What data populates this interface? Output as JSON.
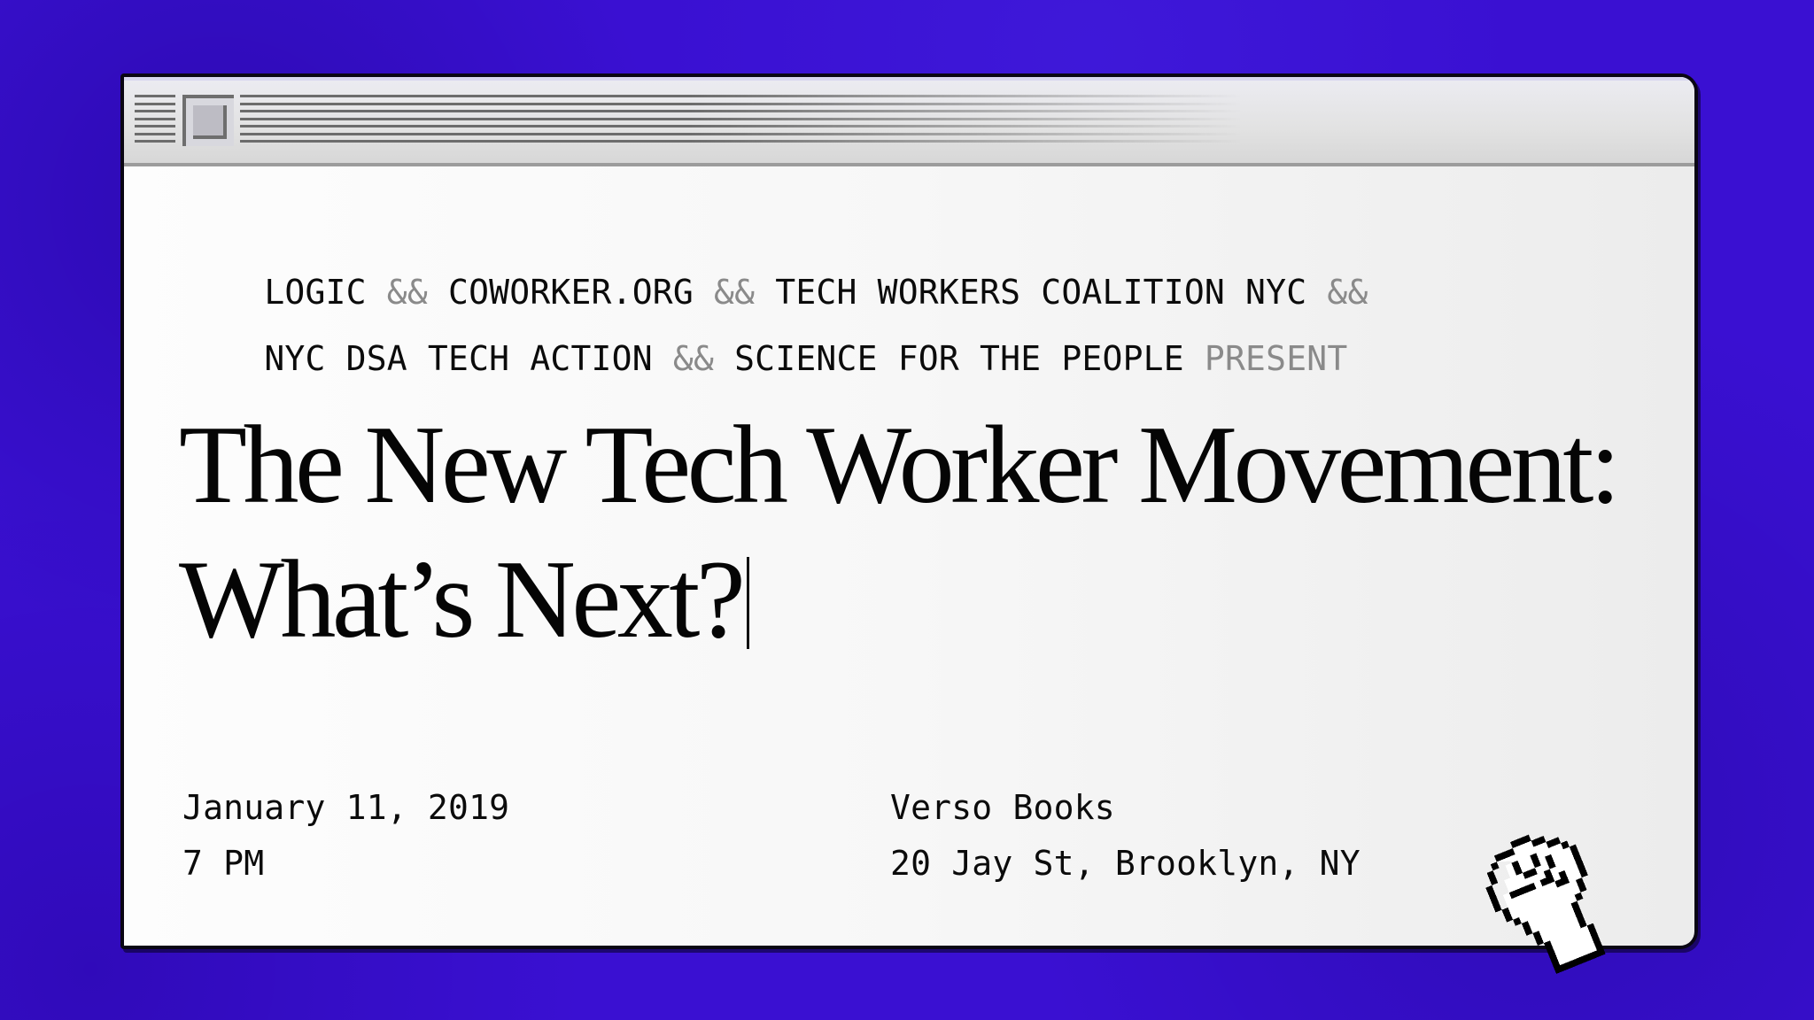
{
  "window": {
    "title_bar": {
      "grip_icon": "title-bar-grip",
      "close_box_icon": "close-box"
    }
  },
  "presenters": {
    "line1": [
      {
        "text": "LOGIC",
        "dim": false
      },
      {
        "text": " && ",
        "dim": true
      },
      {
        "text": "COWORKER.ORG",
        "dim": false
      },
      {
        "text": " && ",
        "dim": true
      },
      {
        "text": "TECH WORKERS COALITION NYC",
        "dim": false
      },
      {
        "text": " &&",
        "dim": true
      }
    ],
    "line2": [
      {
        "text": "NYC DSA TECH ACTION",
        "dim": false
      },
      {
        "text": " && ",
        "dim": true
      },
      {
        "text": "SCIENCE FOR THE PEOPLE",
        "dim": false
      },
      {
        "text": " PRESENT",
        "dim": true
      }
    ]
  },
  "event": {
    "title_line1": "The New Tech Worker Movement:",
    "title_line2": "What’s Next?",
    "date": "January 11, 2019",
    "time": "7 PM",
    "venue": "Verso Books",
    "address": "20 Jay St, Brooklyn, NY"
  },
  "cursor": {
    "icon": "raised-fist-cursor"
  },
  "colors": {
    "background": "#3a10d2",
    "text": "#0b0b0b",
    "separator": "#8a8a8a"
  }
}
